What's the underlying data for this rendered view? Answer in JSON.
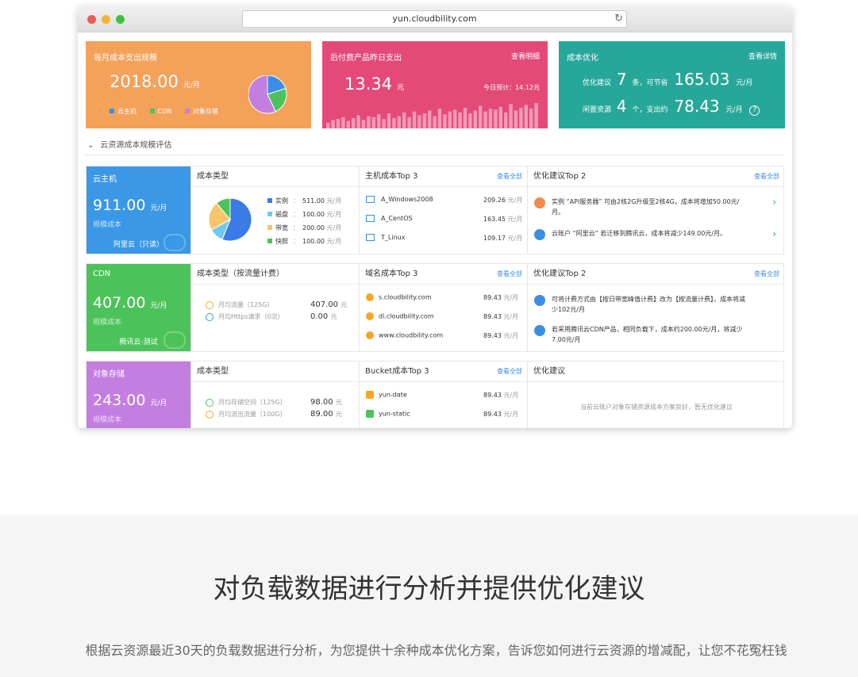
{
  "browser": {
    "url": "yun.cloudbility.com"
  },
  "cards": {
    "monthly": {
      "title": "每月成本支出规模",
      "value": "2018.00",
      "unit": "元/月",
      "legend": [
        "云主机",
        "CDN",
        "对象存储"
      ],
      "pie": [
        {
          "label": "云主机",
          "value": 0.2,
          "color": "#3a8ee6"
        },
        {
          "label": "CDN",
          "value": 0.23,
          "color": "#4cc35a"
        },
        {
          "label": "对象存储",
          "value": 0.57,
          "color": "#c37ee0"
        }
      ]
    },
    "postpaid": {
      "title": "后付费产品昨日支出",
      "link": "查看明细",
      "value": "13.34",
      "unit": "元",
      "forecast": "今日预计：14.12元",
      "bars": [
        6,
        9,
        10,
        12,
        8,
        11,
        14,
        9,
        13,
        12,
        15,
        10,
        16,
        11,
        13,
        17,
        12,
        18,
        14,
        16,
        19,
        13,
        21,
        15,
        18,
        20,
        17,
        22,
        16,
        19,
        24,
        18,
        21,
        20,
        23,
        17,
        26,
        19,
        22,
        25,
        21,
        27
      ]
    },
    "optimize": {
      "title": "成本优化",
      "link": "查看详情",
      "label1": "优化建议",
      "count1": "7",
      "unit1": "条，可节省",
      "save1": "165.03",
      "money_unit": "元/月",
      "label2": "闲置资源",
      "count2": "4",
      "unit2": "个，支出约",
      "save2": "78.43",
      "help_icon": "question-circle-icon"
    }
  },
  "section_title": "云资源成本规模评估",
  "rows": {
    "vm": {
      "name": "云主机",
      "value": "911.00",
      "unit": "元/月",
      "sub": "规模成本",
      "foot": "阿里云（只读）",
      "color": "#3a98e6",
      "col1_title": "成本类型",
      "types": [
        {
          "label": "实例",
          "value": "511.00",
          "unit": "元/月",
          "color": "#3a7be6"
        },
        {
          "label": "磁盘",
          "value": "100.00",
          "unit": "元/月",
          "color": "#6ec9f0"
        },
        {
          "label": "带宽",
          "value": "200.00",
          "unit": "元/月",
          "color": "#f7c56a"
        },
        {
          "label": "快照",
          "value": "100.00",
          "unit": "元/月",
          "color": "#4cc35a"
        }
      ],
      "col2_title": "主机成本Top 3",
      "col2_more": "查看全部",
      "top": [
        {
          "name": "A_Windows2008",
          "value": "209.26",
          "unit": "元/月"
        },
        {
          "name": "A_CentOS",
          "value": "163.45",
          "unit": "元/月"
        },
        {
          "name": "T_Linux",
          "value": "109.17",
          "unit": "元/月"
        }
      ],
      "col3_title": "优化建议Top 2",
      "col3_more": "查看全部",
      "sugs": [
        "实例 “API服务器” 可由2核2G升级至2核4G，成本将增加50.00元/月。",
        "云账户 “阿里云” 若迁移到腾讯云，成本将减少149.00元/月。"
      ]
    },
    "cdn": {
      "name": "CDN",
      "value": "407.00",
      "unit": "元/月",
      "sub": "规模成本",
      "foot": "腾讯云-测试",
      "color": "#4cc35a",
      "col1_title": "成本类型（按流量计费）",
      "types": [
        {
          "label": "月均流量（125G）",
          "value": "407.00",
          "unit": "元"
        },
        {
          "label": "月均Https请求（0次）",
          "value": "0.00",
          "unit": "元"
        }
      ],
      "col2_title": "域名成本Top 3",
      "col2_more": "查看全部",
      "top": [
        {
          "name": "s.cloudbility.com",
          "value": "89.43",
          "unit": "元/月"
        },
        {
          "name": "dl.cloudbility.com",
          "value": "89.43",
          "unit": "元/月"
        },
        {
          "name": "www.cloudbility.com",
          "value": "89.43",
          "unit": "元/月"
        }
      ],
      "col3_title": "优化建议Top 2",
      "col3_more": "查看全部",
      "sugs": [
        "可将计费方式由【按日带宽峰值计费】改为【按流量计费】，成本将减少102元/月",
        "若采用腾讯云CDN产品，相同负载下，成本约200.00元/月，将减少7.00元/月"
      ]
    },
    "oss": {
      "name": "对象存储",
      "value": "243.00",
      "unit": "元/月",
      "sub": "规模成本",
      "color": "#c37ee0",
      "col1_title": "成本类型",
      "types": [
        {
          "label": "月均存储空间（125G）",
          "value": "98.00",
          "unit": "元"
        },
        {
          "label": "月均流出流量（100G）",
          "value": "89.00",
          "unit": "元"
        }
      ],
      "col2_title": "Bucket成本Top 3",
      "col2_more": "查看全部",
      "top": [
        {
          "name": "yun-date",
          "value": "89.43",
          "unit": "元/月"
        },
        {
          "name": "yun-static",
          "value": "89.43",
          "unit": "元/月"
        }
      ],
      "col3_title": "优化建议",
      "empty": "当前云账户对象存储资源成本方案良好，暂无优化建议"
    }
  },
  "headline": "对负载数据进行分析并提供优化建议",
  "subline": "根据云资源最近30天的负载数据进行分析，为您提供十余种成本优化方案，告诉您如何进行云资源的增减配，让您不花冤枉钱"
}
